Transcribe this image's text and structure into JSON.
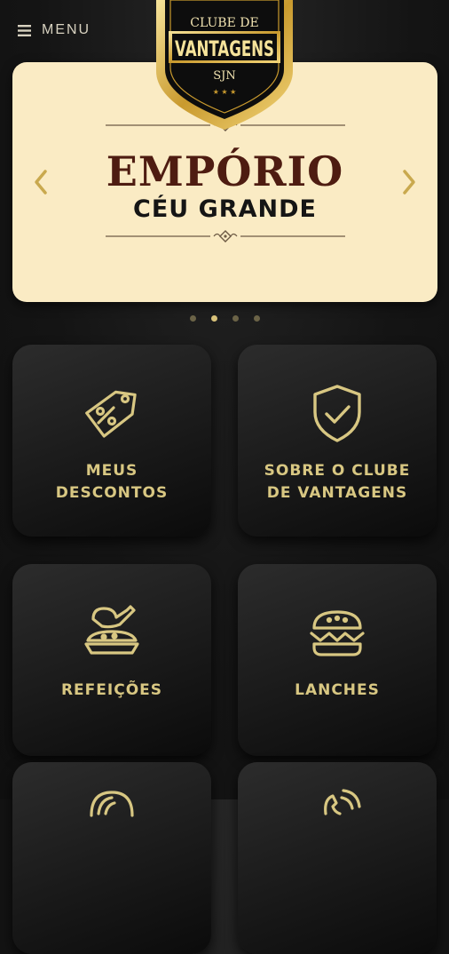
{
  "header": {
    "menu_label": "MENU",
    "menu_icon": "hamburger-icon"
  },
  "logo": {
    "line1": "CLUBE DE",
    "line2": "VANTAGENS",
    "line3": "SJN"
  },
  "banner": {
    "title": "EMPÓRIO",
    "subtitle": "CÉU GRANDE",
    "left_arrow_icon": "chevron-left-icon",
    "right_arrow_icon": "chevron-right-icon",
    "slide_count": 4,
    "active_slide": 2
  },
  "colors": {
    "background": "#141414",
    "gold": "#d8c782",
    "banner_bg": "#faebc4",
    "banner_title": "#4e1c11"
  },
  "cards": [
    {
      "line1": "MEUS",
      "line2": "DESCONTOS",
      "icon": "discount-tag-icon"
    },
    {
      "line1": "SOBRE O CLUBE",
      "line2": "DE VANTAGENS",
      "icon": "shield-check-icon"
    },
    {
      "line1": "REFEIÇÕES",
      "line2": "",
      "icon": "meal-plate-icon"
    },
    {
      "line1": "LANCHES",
      "line2": "",
      "icon": "burger-icon"
    },
    {
      "line1": "",
      "line2": "",
      "icon": "dessert-icon"
    },
    {
      "line1": "",
      "line2": "",
      "icon": "phone-icon"
    }
  ]
}
